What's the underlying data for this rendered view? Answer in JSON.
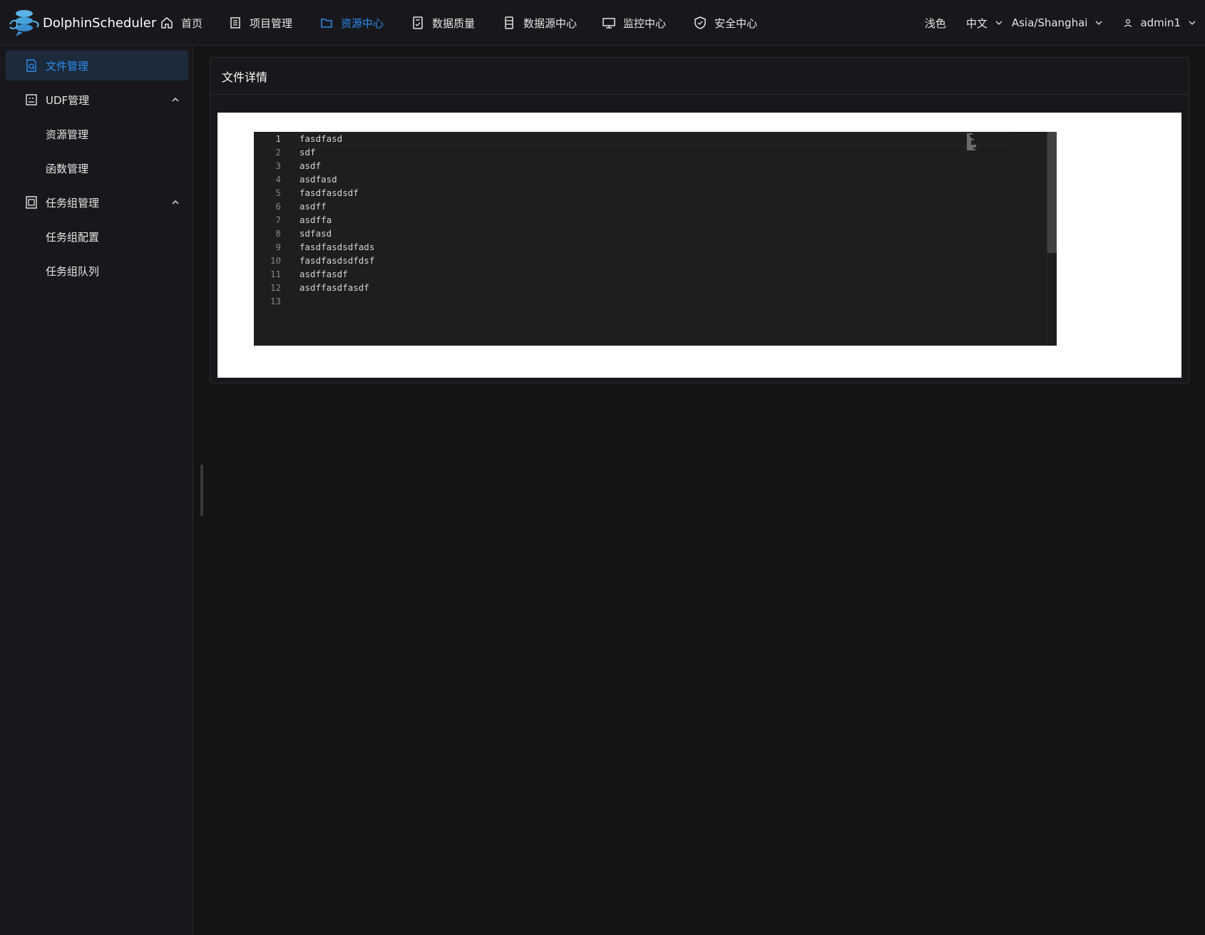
{
  "header": {
    "app_name": "DolphinScheduler",
    "nav": [
      {
        "label": "首页",
        "icon": "home-icon"
      },
      {
        "label": "项目管理",
        "icon": "project-icon"
      },
      {
        "label": "资源中心",
        "icon": "folder-icon",
        "active": true
      },
      {
        "label": "数据质量",
        "icon": "document-check-icon"
      },
      {
        "label": "数据源中心",
        "icon": "database-icon"
      },
      {
        "label": "监控中心",
        "icon": "monitor-icon"
      },
      {
        "label": "安全中心",
        "icon": "shield-icon"
      }
    ],
    "theme_label": "浅色",
    "language_label": "中文",
    "timezone_label": "Asia/Shanghai",
    "user_label": "admin1"
  },
  "sidebar": {
    "items": [
      {
        "label": "文件管理",
        "icon": "file-search-icon",
        "active": true
      },
      {
        "label": "UDF管理",
        "icon": "udf-icon",
        "expanded": true
      },
      {
        "label": "资源管理"
      },
      {
        "label": "函数管理"
      },
      {
        "label": "任务组管理",
        "icon": "task-group-icon",
        "expanded": true
      },
      {
        "label": "任务组配置"
      },
      {
        "label": "任务组队列"
      }
    ]
  },
  "main": {
    "card_title": "文件详情",
    "editor": {
      "lines": [
        "fasdfasd",
        "sdf",
        "asdf",
        "asdfasd",
        "fasdfasdsdf",
        "asdff",
        "asdffa",
        "sdfasd",
        "fasdfasdsdfads",
        "fasdfasdsdfdsf",
        "asdffasdf",
        "asdffasdfasdf",
        ""
      ],
      "line_numbers": [
        "1",
        "2",
        "3",
        "4",
        "5",
        "6",
        "7",
        "8",
        "9",
        "10",
        "11",
        "12",
        "13"
      ]
    }
  },
  "colors": {
    "accent": "#2d8cf0",
    "background": "#141414",
    "panel": "#18181c"
  }
}
